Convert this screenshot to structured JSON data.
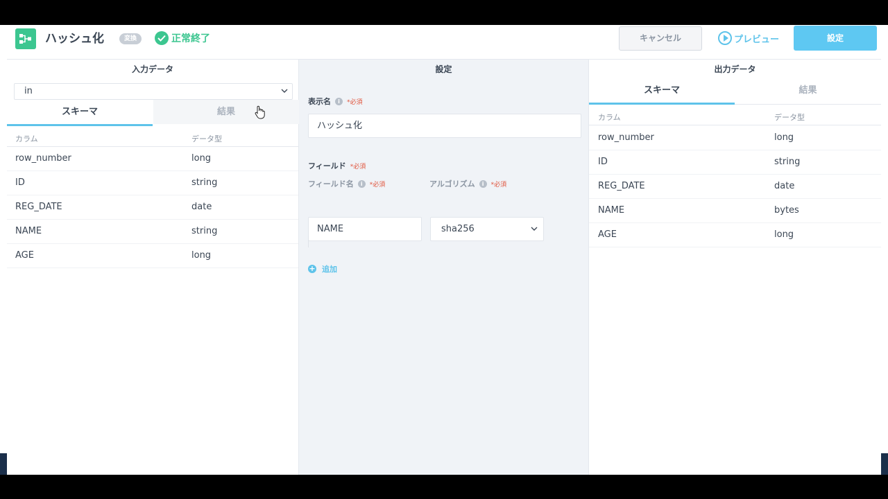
{
  "header": {
    "title": "ハッシュ化",
    "tag": "変換",
    "status": "正常終了",
    "cancel_label": "キャンセル",
    "preview_label": "プレビュー",
    "settings_label": "設定"
  },
  "input_panel": {
    "title": "入力データ",
    "source_select": "in",
    "tabs": [
      "スキーマ",
      "結果"
    ],
    "active_tab": "スキーマ",
    "columns": [
      "カラム",
      "データ型"
    ],
    "rows": [
      {
        "column": "row_number",
        "type": "long"
      },
      {
        "column": "ID",
        "type": "string"
      },
      {
        "column": "REG_DATE",
        "type": "date"
      },
      {
        "column": "NAME",
        "type": "string"
      },
      {
        "column": "AGE",
        "type": "long"
      }
    ]
  },
  "settings_panel": {
    "title": "設定",
    "display_name_label": "表示名",
    "required_label": "*必須",
    "display_name_value": "ハッシュ化",
    "fields_label": "フィールド",
    "field_name_label": "フィールド名",
    "algorithm_label": "アルゴリズム",
    "field_name_value": "NAME",
    "algorithm_value": "sha256",
    "add_label": "追加"
  },
  "output_panel": {
    "title": "出力データ",
    "tabs": [
      "スキーマ",
      "結果"
    ],
    "active_tab": "スキーマ",
    "columns": [
      "カラム",
      "データ型"
    ],
    "rows": [
      {
        "column": "row_number",
        "type": "long"
      },
      {
        "column": "ID",
        "type": "string"
      },
      {
        "column": "REG_DATE",
        "type": "date"
      },
      {
        "column": "NAME",
        "type": "bytes"
      },
      {
        "column": "AGE",
        "type": "long"
      }
    ]
  },
  "colors": {
    "accent": "#5ec3ea",
    "success": "#3cc690",
    "required": "#e0543c"
  },
  "icons": {
    "logo": "flow-node-icon",
    "status": "check-circle-icon",
    "preview": "play-circle-icon"
  }
}
